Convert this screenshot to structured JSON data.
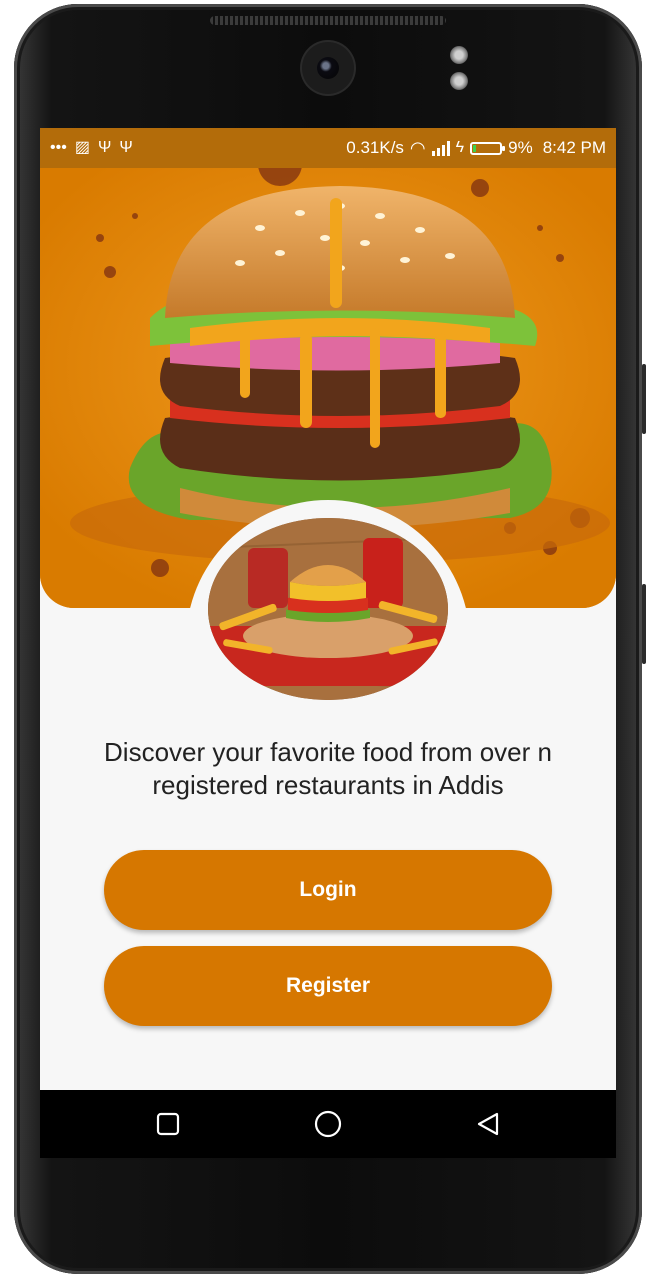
{
  "status_bar": {
    "left_icons": [
      "more-dots-icon",
      "cast-icon",
      "usb-icon",
      "usb-icon"
    ],
    "net_speed": "0.31K/s",
    "battery_percent": "9%",
    "battery_level": 0.09,
    "time": "8:42 PM",
    "bg_color": "#b36c0a"
  },
  "hero": {
    "bg_color": "#d97b00",
    "image": "burger-photo"
  },
  "featured_image": "burger-and-fries-photo",
  "tagline": "Discover your favorite food from over n registered restaurants in Addis",
  "buttons": {
    "login": "Login",
    "register": "Register"
  },
  "colors": {
    "accent": "#d67700",
    "background": "#f7f7f7"
  },
  "nav": {
    "items": [
      "recents-square-icon",
      "home-circle-icon",
      "back-triangle-icon"
    ]
  }
}
